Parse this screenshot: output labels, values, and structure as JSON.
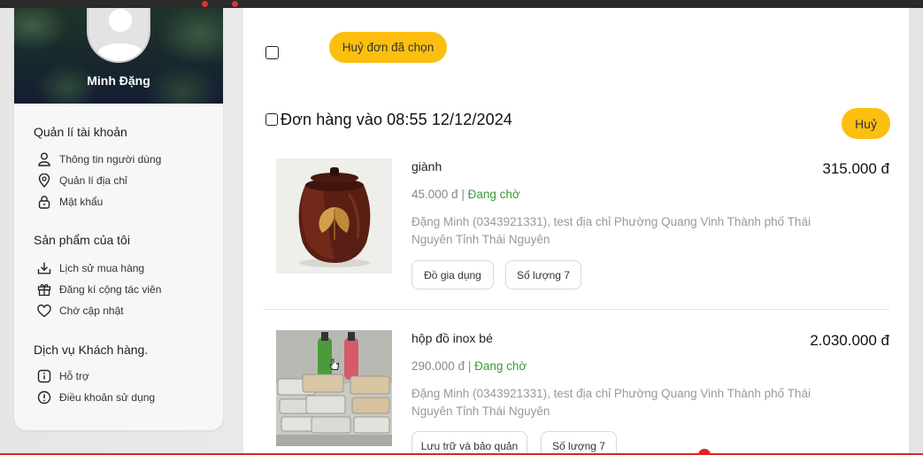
{
  "profile": {
    "name": "Minh Đặng"
  },
  "sidebar": {
    "sections": [
      {
        "title": "Quản lí tài khoản",
        "items": [
          {
            "label": "Thông tin người dùng",
            "icon": "user-icon"
          },
          {
            "label": "Quản lí địa chỉ",
            "icon": "location-pin-icon"
          },
          {
            "label": "Mật khẩu",
            "icon": "lock-icon"
          }
        ]
      },
      {
        "title": "Sản phẩm của tôi",
        "items": [
          {
            "label": "Lịch sử mua hàng",
            "icon": "download-tray-icon"
          },
          {
            "label": "Đăng kí cộng tác viên",
            "icon": "gift-icon"
          },
          {
            "label": "Chờ cập nhật",
            "icon": "heart-icon"
          }
        ]
      },
      {
        "title": "Dịch vụ Khách hàng.",
        "items": [
          {
            "label": "Hỗ trợ",
            "icon": "info-square-icon"
          },
          {
            "label": "Điều khoản sử dụng",
            "icon": "alert-circle-icon"
          }
        ]
      }
    ]
  },
  "toolbar": {
    "cancel_selected_label": "Huỷ đơn đã chọn"
  },
  "order": {
    "title": "Đơn hàng vào  08:55 12/12/2024",
    "cancel_label": "Huỷ",
    "items": [
      {
        "name": "giành",
        "unit_price": "45.000 đ",
        "separator": " | ",
        "status": "Đang chờ",
        "total": "315.000 đ",
        "address": "Đặng Minh (0343921331), test địa chỉ Phường Quang Vinh Thành phố Thái Nguyên Tỉnh Thái Nguyên",
        "category": "Đồ gia dụng",
        "quantity": "Số lượng 7"
      },
      {
        "name": "hộp đồ inox bé",
        "unit_price": "290.000 đ",
        "separator": " | ",
        "status": "Đang chờ",
        "total": "2.030.000 đ",
        "address": "Đặng Minh (0343921331), test địa chỉ Phường Quang Vinh Thành phố Thái Nguyên Tỉnh Thái Nguyên",
        "category": "Lưu trữ và bảo quản",
        "quantity": "Số lượng 7"
      }
    ]
  },
  "colors": {
    "accent_yellow": "#fcbf0f",
    "status_green": "#3a9a3a",
    "recording_red": "#e02424"
  }
}
